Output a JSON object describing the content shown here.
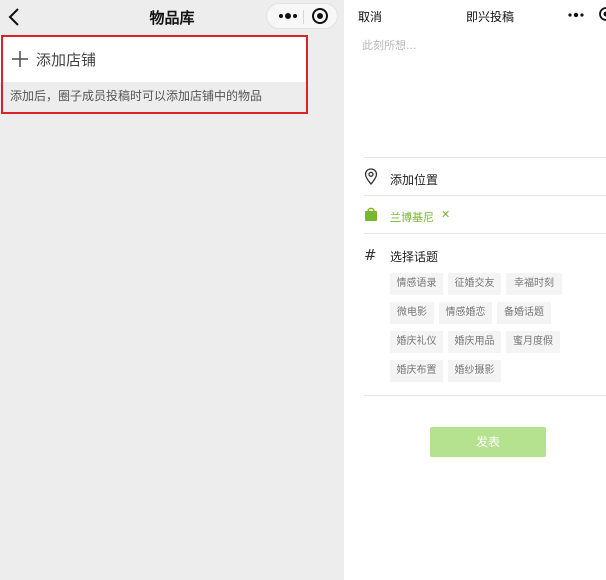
{
  "left_panel": {
    "title": "物品库",
    "add_shop_label": "添加店铺",
    "hint": "添加后，圈子成员投稿时可以添加店铺中的物品"
  },
  "right_panel": {
    "cancel": "取消",
    "title": "即兴投稿",
    "placeholder": "此刻所想...",
    "location_label": "添加位置",
    "shop_tag": "兰博基尼",
    "shop_tag_close": "✕",
    "topic_label": "选择话题",
    "topic_hash": "#",
    "topics": [
      "情感语录",
      "征婚交友",
      "幸福时刻",
      "微电影",
      "情感婚恋",
      "备婚话题",
      "婚庆礼仪",
      "婚庆用品",
      "蜜月度假",
      "婚庆布置",
      "婚纱摄影"
    ],
    "publish": "发表"
  },
  "colors": {
    "accent_green": "#78b72e",
    "publish_green": "#b5e28f",
    "highlight_red": "#d9232a"
  },
  "icons": [
    "back-arrow-icon",
    "more-dots-icon",
    "target-icon",
    "plus-icon",
    "location-pin-icon",
    "shopping-bag-icon",
    "hash-icon",
    "close-icon"
  ]
}
